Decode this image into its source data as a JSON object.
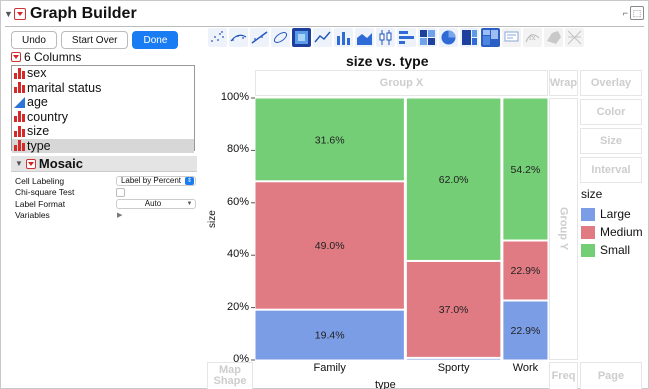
{
  "app": {
    "title": "Graph Builder"
  },
  "buttons": {
    "undo": "Undo",
    "start_over": "Start Over",
    "done": "Done"
  },
  "columns": {
    "header": "6 Columns",
    "items": [
      {
        "label": "sex",
        "icon": "nominal-bars-icon"
      },
      {
        "label": "marital status",
        "icon": "nominal-bars-icon"
      },
      {
        "label": "age",
        "icon": "continuous-triangle-icon"
      },
      {
        "label": "country",
        "icon": "nominal-bars-icon"
      },
      {
        "label": "size",
        "icon": "nominal-bars-icon"
      },
      {
        "label": "type",
        "icon": "nominal-bars-icon",
        "selected": true
      }
    ]
  },
  "mosaic": {
    "header": "Mosaic",
    "cell_labeling_label": "Cell Labeling",
    "cell_labeling_value": "Label by Percent",
    "chi_square_label": "Chi-square Test",
    "label_format_label": "Label Format",
    "label_format_value": "Auto",
    "variables_label": "Variables"
  },
  "zones": {
    "group_x": "Group X",
    "group_y": "Group Y",
    "wrap": "Wrap",
    "overlay": "Overlay",
    "color": "Color",
    "size": "Size",
    "interval": "Interval",
    "freq": "Freq",
    "page": "Page",
    "map_shape_line1": "Map",
    "map_shape_line2": "Shape"
  },
  "colors": {
    "large": "#7b9de6",
    "medium": "#e07b84",
    "small": "#73ce76",
    "accent": "#1a7cf2",
    "nominal_icon": "#d42a2a"
  },
  "chart_data": {
    "type": "mosaic",
    "title": "size vs. type",
    "xlabel": "type",
    "ylabel": "size",
    "categories": [
      "Family",
      "Sporty",
      "Work"
    ],
    "category_widths": [
      0.49,
      0.31,
      0.148
    ],
    "y_ticks": [
      "0%",
      "20%",
      "40%",
      "60%",
      "80%",
      "100%"
    ],
    "series": [
      {
        "name": "Large",
        "values": [
          19.4,
          1.0,
          22.9
        ],
        "labels": [
          "19.4%",
          "",
          "22.9%"
        ]
      },
      {
        "name": "Medium",
        "values": [
          49.0,
          37.0,
          22.9
        ],
        "labels": [
          "49.0%",
          "37.0%",
          "22.9%"
        ]
      },
      {
        "name": "Small",
        "values": [
          31.6,
          62.0,
          54.2
        ],
        "labels": [
          "31.6%",
          "62.0%",
          "54.2%"
        ]
      }
    ],
    "legend": {
      "title": "size",
      "entries": [
        "Large",
        "Medium",
        "Small"
      ],
      "position": "right"
    },
    "ylim": [
      0,
      100
    ]
  }
}
